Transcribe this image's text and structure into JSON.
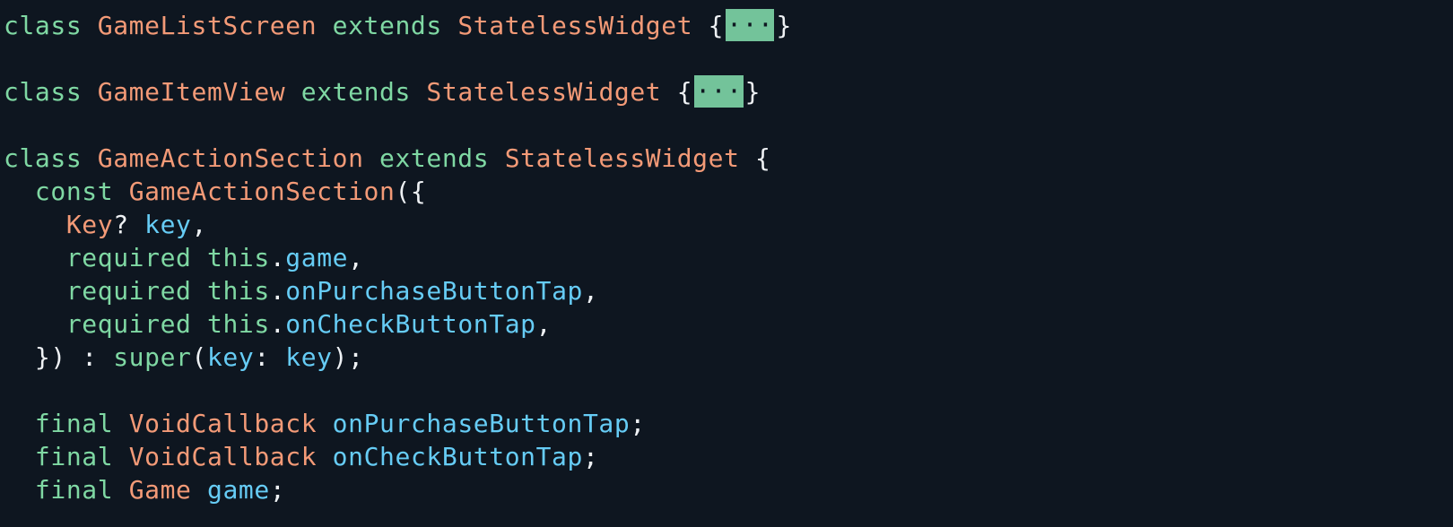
{
  "colors": {
    "background": "#0e1620",
    "keyword": "#7fd8a3",
    "type": "#f39a77",
    "identifier": "#66ccf5",
    "punctuation": "#eef1f4",
    "fold_marker_bg": "#73c39a"
  },
  "lines": [
    [
      {
        "t": "class",
        "k": "keyword"
      },
      {
        "t": " ",
        "k": "punct"
      },
      {
        "t": "GameListScreen",
        "k": "type"
      },
      {
        "t": " ",
        "k": "punct"
      },
      {
        "t": "extends",
        "k": "keyword"
      },
      {
        "t": " ",
        "k": "punct"
      },
      {
        "t": "StatelessWidget",
        "k": "type"
      },
      {
        "t": " {",
        "k": "punct"
      },
      {
        "t": "···",
        "k": "fold"
      },
      {
        "t": "}",
        "k": "punct"
      }
    ],
    [],
    [
      {
        "t": "class",
        "k": "keyword"
      },
      {
        "t": " ",
        "k": "punct"
      },
      {
        "t": "GameItemView",
        "k": "type"
      },
      {
        "t": " ",
        "k": "punct"
      },
      {
        "t": "extends",
        "k": "keyword"
      },
      {
        "t": " ",
        "k": "punct"
      },
      {
        "t": "StatelessWidget",
        "k": "type"
      },
      {
        "t": " {",
        "k": "punct"
      },
      {
        "t": "···",
        "k": "fold"
      },
      {
        "t": "}",
        "k": "punct"
      }
    ],
    [],
    [
      {
        "t": "class",
        "k": "keyword"
      },
      {
        "t": " ",
        "k": "punct"
      },
      {
        "t": "GameActionSection",
        "k": "type"
      },
      {
        "t": " ",
        "k": "punct"
      },
      {
        "t": "extends",
        "k": "keyword"
      },
      {
        "t": " ",
        "k": "punct"
      },
      {
        "t": "StatelessWidget",
        "k": "type"
      },
      {
        "t": " {",
        "k": "punct"
      }
    ],
    [
      {
        "t": "  ",
        "k": "punct"
      },
      {
        "t": "const",
        "k": "keyword"
      },
      {
        "t": " ",
        "k": "punct"
      },
      {
        "t": "GameActionSection",
        "k": "type"
      },
      {
        "t": "({",
        "k": "punct"
      }
    ],
    [
      {
        "t": "    ",
        "k": "punct"
      },
      {
        "t": "Key",
        "k": "type"
      },
      {
        "t": "? ",
        "k": "punct"
      },
      {
        "t": "key",
        "k": "ident"
      },
      {
        "t": ",",
        "k": "punct"
      }
    ],
    [
      {
        "t": "    ",
        "k": "punct"
      },
      {
        "t": "required",
        "k": "keyword"
      },
      {
        "t": " ",
        "k": "punct"
      },
      {
        "t": "this",
        "k": "keyword"
      },
      {
        "t": ".",
        "k": "punct"
      },
      {
        "t": "game",
        "k": "ident"
      },
      {
        "t": ",",
        "k": "punct"
      }
    ],
    [
      {
        "t": "    ",
        "k": "punct"
      },
      {
        "t": "required",
        "k": "keyword"
      },
      {
        "t": " ",
        "k": "punct"
      },
      {
        "t": "this",
        "k": "keyword"
      },
      {
        "t": ".",
        "k": "punct"
      },
      {
        "t": "onPurchaseButtonTap",
        "k": "ident"
      },
      {
        "t": ",",
        "k": "punct"
      }
    ],
    [
      {
        "t": "    ",
        "k": "punct"
      },
      {
        "t": "required",
        "k": "keyword"
      },
      {
        "t": " ",
        "k": "punct"
      },
      {
        "t": "this",
        "k": "keyword"
      },
      {
        "t": ".",
        "k": "punct"
      },
      {
        "t": "onCheckButtonTap",
        "k": "ident"
      },
      {
        "t": ",",
        "k": "punct"
      }
    ],
    [
      {
        "t": "  }) : ",
        "k": "punct"
      },
      {
        "t": "super",
        "k": "keyword"
      },
      {
        "t": "(",
        "k": "punct"
      },
      {
        "t": "key",
        "k": "ident"
      },
      {
        "t": ": ",
        "k": "punct"
      },
      {
        "t": "key",
        "k": "ident"
      },
      {
        "t": ");",
        "k": "punct"
      }
    ],
    [],
    [
      {
        "t": "  ",
        "k": "punct"
      },
      {
        "t": "final",
        "k": "keyword"
      },
      {
        "t": " ",
        "k": "punct"
      },
      {
        "t": "VoidCallback",
        "k": "type"
      },
      {
        "t": " ",
        "k": "punct"
      },
      {
        "t": "onPurchaseButtonTap",
        "k": "ident"
      },
      {
        "t": ";",
        "k": "punct"
      }
    ],
    [
      {
        "t": "  ",
        "k": "punct"
      },
      {
        "t": "final",
        "k": "keyword"
      },
      {
        "t": " ",
        "k": "punct"
      },
      {
        "t": "VoidCallback",
        "k": "type"
      },
      {
        "t": " ",
        "k": "punct"
      },
      {
        "t": "onCheckButtonTap",
        "k": "ident"
      },
      {
        "t": ";",
        "k": "punct"
      }
    ],
    [
      {
        "t": "  ",
        "k": "punct"
      },
      {
        "t": "final",
        "k": "keyword"
      },
      {
        "t": " ",
        "k": "punct"
      },
      {
        "t": "Game",
        "k": "type"
      },
      {
        "t": " ",
        "k": "punct"
      },
      {
        "t": "game",
        "k": "ident"
      },
      {
        "t": ";",
        "k": "punct"
      }
    ]
  ]
}
